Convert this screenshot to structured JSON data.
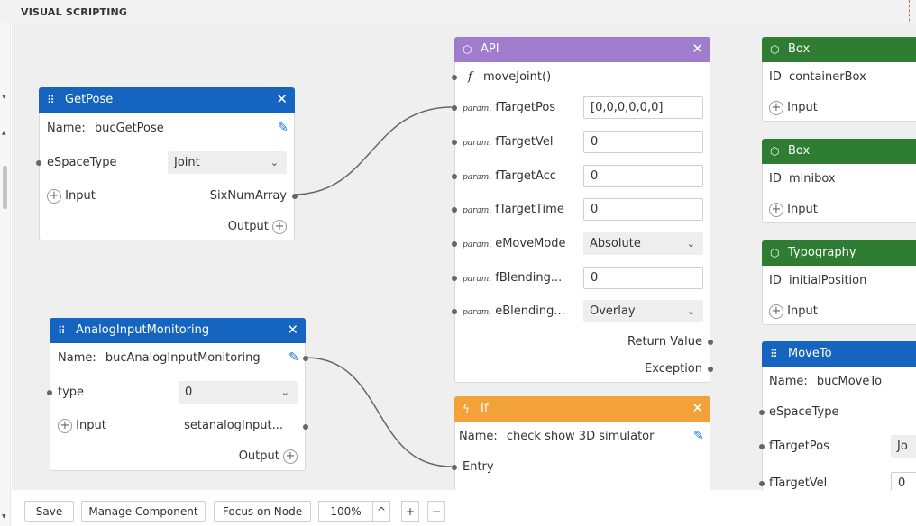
{
  "panel": {
    "title": "VISUAL SCRIPTING"
  },
  "colors": {
    "blue": "#1565c0",
    "purple": "#a07ccd",
    "green": "#2e7d32",
    "orange": "#f3a23a",
    "edit": "#1976d2"
  },
  "icons": {
    "drag": "drag-handle-icon",
    "cube": "cube-icon",
    "bolt": "bolt-icon",
    "close": "close-icon",
    "edit": "edit-icon",
    "chevron": "chevron-down-icon",
    "plus": "plus-icon"
  },
  "nodes": {
    "getpose": {
      "title": "GetPose",
      "name_label": "Name:",
      "name_value": "bucGetPose",
      "espace_label": "eSpaceType",
      "espace_value": "Joint",
      "input_label": "Input",
      "output_port_label": "SixNumArray",
      "output_label": "Output"
    },
    "analog": {
      "title": "AnalogInputMonitoring",
      "name_label": "Name:",
      "name_value": "bucAnalogInputMonitoring",
      "type_label": "type",
      "type_value": "0",
      "input_label": "Input",
      "output_port_label": "setanalogInput...",
      "output_label": "Output"
    },
    "api": {
      "title": "API",
      "function": "moveJoint()",
      "param_tag": "param.",
      "params": [
        {
          "label": "fTargetPos",
          "value": "[0,0,0,0,0,0]"
        },
        {
          "label": "fTargetVel",
          "value": "0"
        },
        {
          "label": "fTargetAcc",
          "value": "0"
        },
        {
          "label": "fTargetTime",
          "value": "0"
        },
        {
          "label": "eMoveMode",
          "value": "Absolute"
        },
        {
          "label": "fBlending...",
          "value": "0"
        },
        {
          "label": "eBlending...",
          "value": "Overlay"
        }
      ],
      "return_label": "Return Value",
      "exception_label": "Exception"
    },
    "if": {
      "title": "If",
      "name_label": "Name:",
      "name_value": "check show 3D simulator",
      "entry_label": "Entry"
    },
    "box1": {
      "title": "Box",
      "id_label": "ID",
      "id_value": "containerBox",
      "input_label": "Input"
    },
    "box2": {
      "title": "Box",
      "id_label": "ID",
      "id_value": "minibox",
      "input_label": "Input"
    },
    "typography": {
      "title": "Typography",
      "id_label": "ID",
      "id_value": "initialPosition",
      "input_label": "Input"
    },
    "moveto": {
      "title": "MoveTo",
      "name_label": "Name:",
      "name_value": "bucMoveTo",
      "espace_label": "eSpaceType",
      "ftargetpos_label": "fTargetPos",
      "ftargetpos_value": "Jo",
      "ftargetvel_label": "fTargetVel",
      "ftargetvel_value": "0"
    }
  },
  "toolbar": {
    "save": "Save",
    "manage": "Manage Component",
    "focus": "Focus on Node",
    "zoom": "100%",
    "zoom_step_up": "^",
    "zoom_in": "+",
    "zoom_out": "−"
  }
}
